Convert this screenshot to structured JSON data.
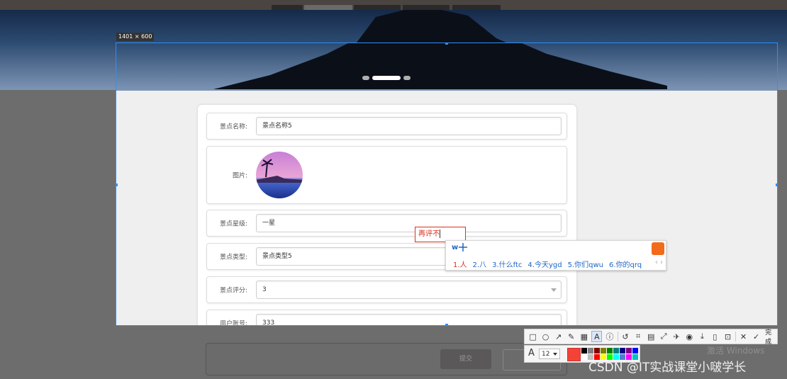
{
  "selection": {
    "size_label": "1401 × 600"
  },
  "form": {
    "rows": [
      {
        "label": "景点名称:",
        "value": "景点名称5"
      },
      {
        "label": "图片:"
      },
      {
        "label": "景点星级:",
        "value": "一星"
      },
      {
        "label": "景点类型:",
        "value": "景点类型5"
      },
      {
        "label": "景点评分:",
        "value": "3"
      },
      {
        "label": "用户账号:",
        "value": "333"
      }
    ],
    "submit_label": "提交"
  },
  "ime": {
    "inline_text": "再评不",
    "composition": "w",
    "candidates": [
      "1.人",
      "2.八",
      "3.什么ftc",
      "4.今天ygd",
      "5.你们qwu",
      "6.你的qrq"
    ],
    "nav": "‹ ›"
  },
  "toolbar": {
    "tools": [
      "rectangle-icon",
      "ellipse-icon",
      "arrow-icon",
      "pen-icon",
      "mosaic-icon",
      "text-icon",
      "serial-number-icon",
      "undo-icon",
      "ocr-icon",
      "screenshot-to-text-icon",
      "scroll-capture-icon",
      "pin-icon",
      "record-icon",
      "save-icon",
      "long-capture-icon",
      "bookmark-icon",
      "close-icon"
    ],
    "done_label": "完成",
    "font_size": "12",
    "current_color": "#f44336",
    "palette": [
      "#000000",
      "#808080",
      "#800000",
      "#808000",
      "#008000",
      "#008080",
      "#000080",
      "#800080",
      "#0000ff",
      "#ffffff",
      "#c0c0c0",
      "#ff0000",
      "#ffff00",
      "#00ff00",
      "#00ffff",
      "#4f7bd4",
      "#ff00ff",
      "#00c0c0"
    ]
  },
  "watermarks": {
    "windows": "激活 Windows",
    "csdn": "CSDN @IT实战课堂小啵学长"
  }
}
